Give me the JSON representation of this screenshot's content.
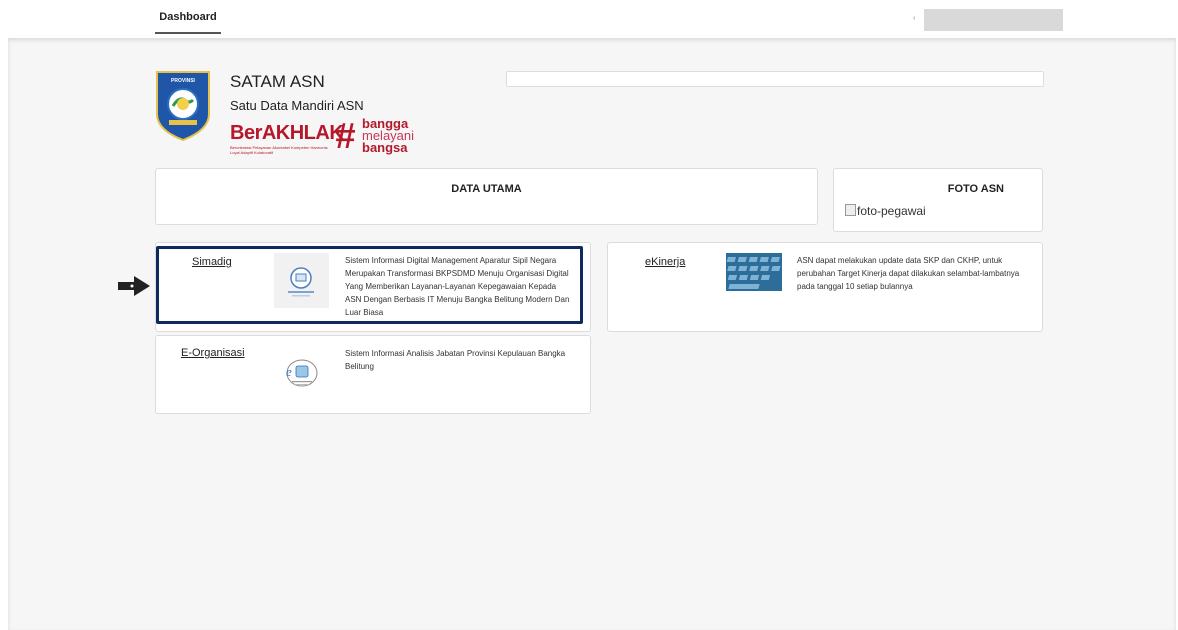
{
  "topbar": {
    "tab_dashboard": "Dashboard",
    "caret": "‹"
  },
  "header": {
    "title": "SATAM ASN",
    "subtitle": "Satu Data Mandiri ASN",
    "logo_text": "PROVINSI",
    "berakhlak": "BerAKHLAK",
    "berakhlak_tagline": "Berorientasi Pelayanan Akuntabel Kompeten Harmonis Loyal Adaptif Kolaboratif",
    "bangga_line1": "bangga",
    "bangga_line2": "melayani",
    "bangga_line3": "bangsa"
  },
  "panels": {
    "data_utama": "DATA UTAMA",
    "foto_asn": "FOTO ASN",
    "foto_alt": "foto-pegawai"
  },
  "services": [
    {
      "name": "Simadig",
      "description": "Sistem Informasi Digital Management Aparatur Sipil Negara Merupakan Transformasi BKPSDMD Menuju Organisasi Digital Yang Memberikan Layanan-Layanan Kepegawaian Kepada ASN Dengan Berbasis IT Menuju Bangka Belitung Modern Dan Luar Biasa"
    },
    {
      "name": "eKinerja",
      "description": "ASN dapat melakukan update data SKP dan CKHP, untuk perubahan Target Kinerja dapat dilakukan selambat-lambatnya pada tanggal 10 setiap bulannya"
    },
    {
      "name": "E-Organisasi",
      "description": "Sistem Informasi Analisis Jabatan Provinsi Kepulauan Bangka Belitung"
    }
  ],
  "colors": {
    "accent_red": "#b5182b",
    "highlight_navy": "#0f2a5c"
  }
}
